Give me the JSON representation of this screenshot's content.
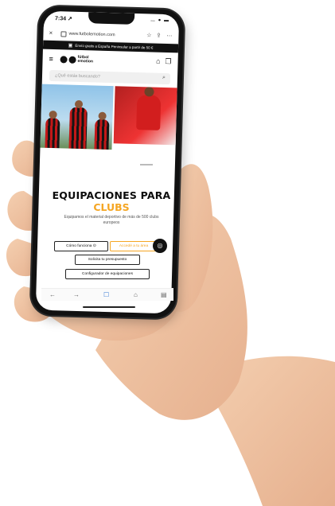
{
  "status": {
    "time": "7:34 ↗",
    "icons": "… ● ▬"
  },
  "browser": {
    "close": "×",
    "url": "www.futbolemotion.com",
    "bookmark": "☆",
    "share": "⇪",
    "more": "⋯"
  },
  "promo": {
    "text": "Envío gratis a España Peninsular a partir de 50 €",
    "truck_icon": "▣"
  },
  "header": {
    "menu_icon": "≡",
    "logo_text": "fútbol emotion",
    "user_icon": "⌂",
    "bag_icon": "❐"
  },
  "search": {
    "placeholder": "¿Qué estás buscando?",
    "icon": "⌕"
  },
  "hero": {
    "title": "EQUIPACIONES PARA",
    "highlight": "CLUBS",
    "description": "Equipamos el material deportivo de más de 500 clubs europeos"
  },
  "buttons": {
    "how": "Cómo funciona",
    "how_icon": "⊙",
    "orange": "Accedé a tu área",
    "quote": "Solicita tu presupuesto",
    "configurator": "Configurador de equipaciones",
    "help_icon": "◎"
  },
  "toolbar": {
    "back": "←",
    "forward": "→",
    "tabs": "☐",
    "home": "⌂",
    "menu": "▤"
  },
  "colors": {
    "accent": "#f5a623",
    "dark": "#111111"
  }
}
